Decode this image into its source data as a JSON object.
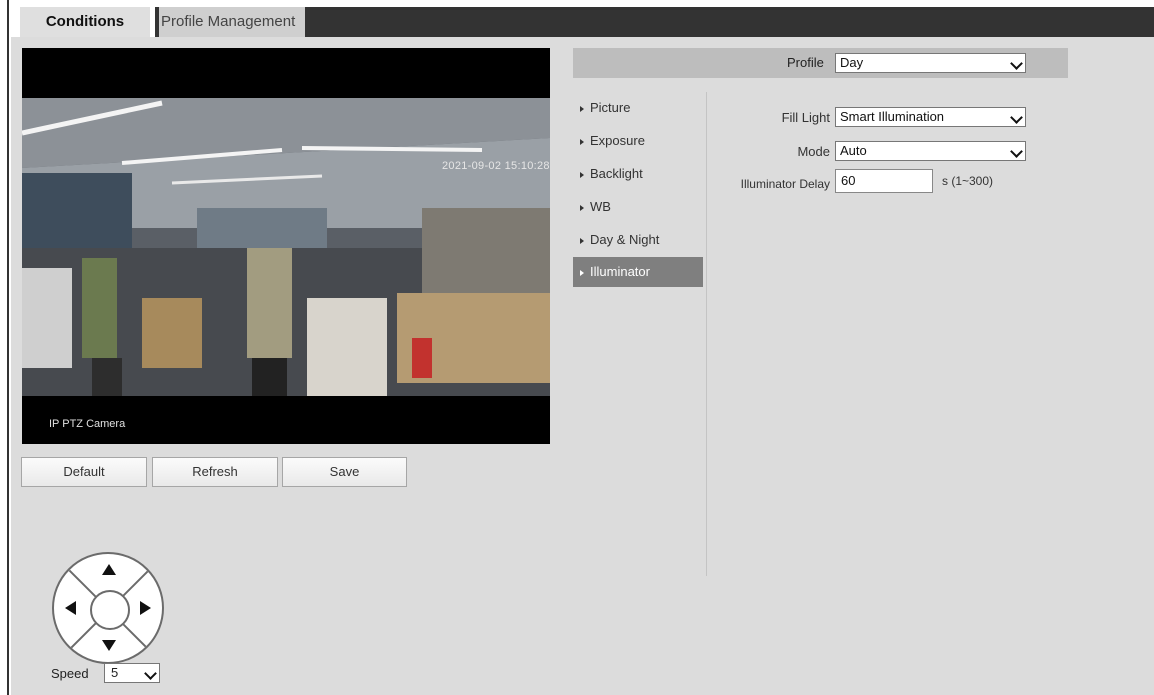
{
  "tabs": [
    {
      "label": "Conditions",
      "active": true
    },
    {
      "label": "Profile Management",
      "active": false
    }
  ],
  "video": {
    "timestamp": "2021-09-02 15:10:28",
    "camera_label": "IP PTZ Camera"
  },
  "actions": {
    "default_label": "Default",
    "refresh_label": "Refresh",
    "save_label": "Save"
  },
  "ptz": {
    "speed_label": "Speed",
    "speed_value": "5"
  },
  "profile": {
    "label": "Profile",
    "value": "Day"
  },
  "menu": {
    "items": [
      {
        "label": "Picture"
      },
      {
        "label": "Exposure"
      },
      {
        "label": "Backlight"
      },
      {
        "label": "WB"
      },
      {
        "label": "Day & Night"
      },
      {
        "label": "Illuminator"
      }
    ],
    "active_index": 5
  },
  "form": {
    "fill_light_label": "Fill Light",
    "fill_light_value": "Smart Illumination",
    "mode_label": "Mode",
    "mode_value": "Auto",
    "delay_label": "Illuminator Delay",
    "delay_value": "60",
    "delay_unit": "s (1~300)"
  },
  "colors": {
    "page_bg": "#dcdcdc",
    "header_dark": "#333333",
    "active_tab": "#dfdfdf",
    "menu_active": "#7f7f7f",
    "profile_bar": "#bdbdbd"
  }
}
